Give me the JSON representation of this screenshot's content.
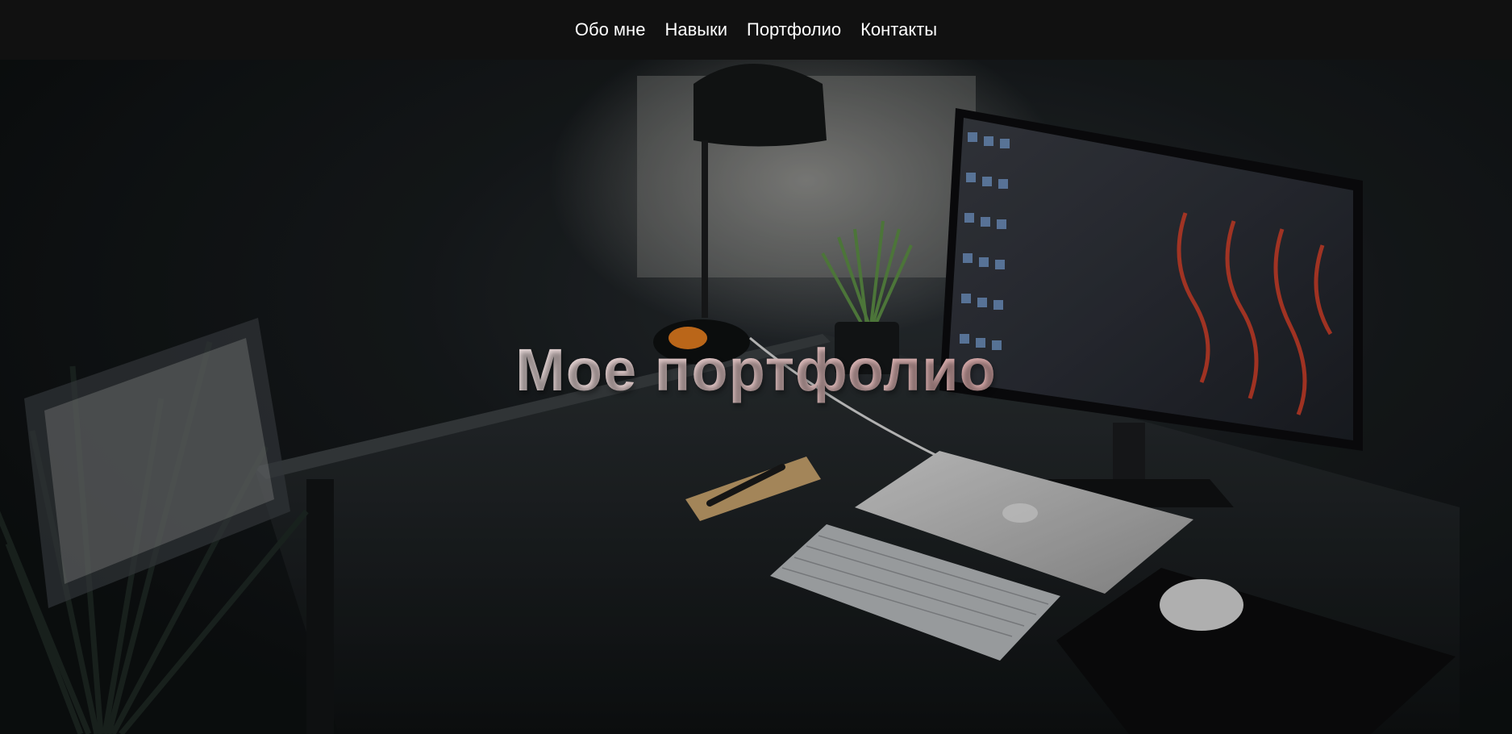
{
  "nav": {
    "items": [
      {
        "label": "Обо мне"
      },
      {
        "label": "Навыки"
      },
      {
        "label": "Портфолио"
      },
      {
        "label": "Контакты"
      }
    ]
  },
  "hero": {
    "title": "Мое портфолио",
    "image_subject": "dark-desk-workspace"
  },
  "colors": {
    "nav_background": "#111111",
    "nav_text": "#ffffff",
    "title_gradient_start": "#d9d6d6",
    "title_gradient_end": "#b06b70"
  }
}
